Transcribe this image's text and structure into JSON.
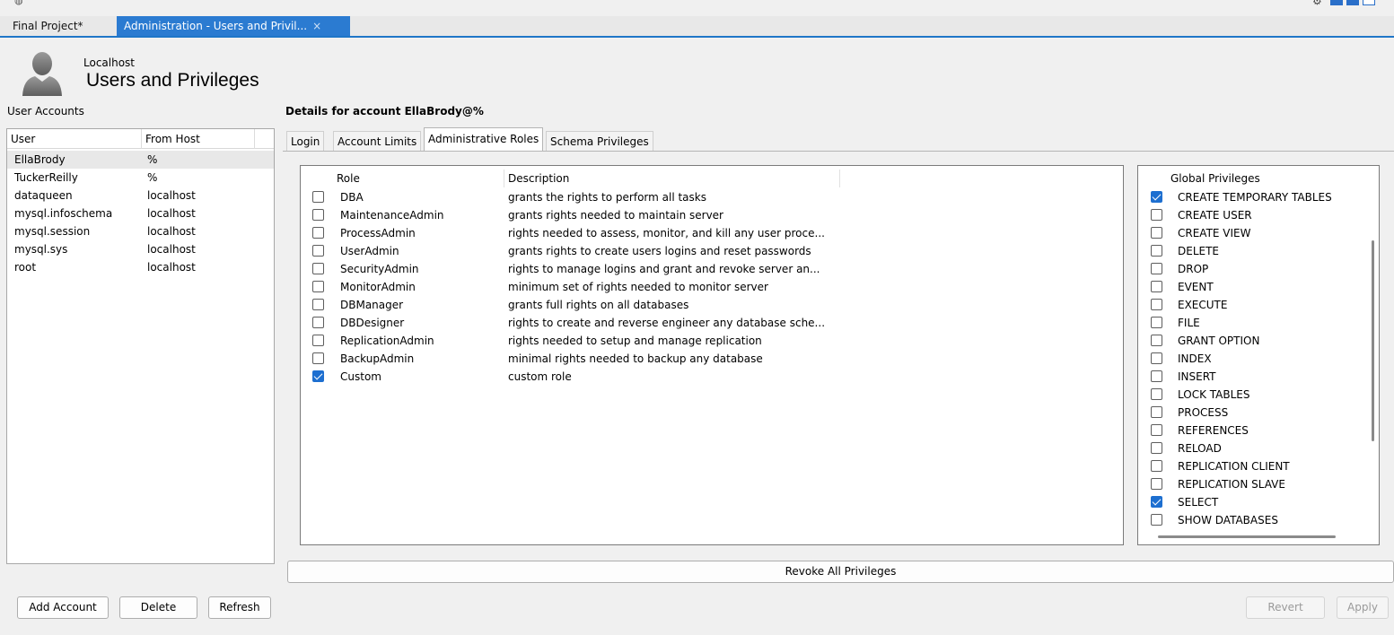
{
  "window": {
    "tabs": [
      "Final Project*",
      "Administration - Users and Privil..."
    ],
    "close_glyph": "×"
  },
  "header": {
    "host": "Localhost",
    "title": "Users and Privileges"
  },
  "accounts": {
    "label": "User Accounts",
    "columns": [
      "User",
      "From Host"
    ],
    "rows": [
      {
        "user": "EllaBrody",
        "host": "%"
      },
      {
        "user": "TuckerReilly",
        "host": "%"
      },
      {
        "user": "dataqueen",
        "host": "localhost"
      },
      {
        "user": "mysql.infoschema",
        "host": "localhost"
      },
      {
        "user": "mysql.session",
        "host": "localhost"
      },
      {
        "user": "mysql.sys",
        "host": "localhost"
      },
      {
        "user": "root",
        "host": "localhost"
      }
    ],
    "selected_index": 0
  },
  "buttons": {
    "add_account": "Add Account",
    "delete": "Delete",
    "refresh": "Refresh",
    "revoke_all": "Revoke All Privileges",
    "revert": "Revert",
    "apply": "Apply"
  },
  "details": {
    "title": "Details for account EllaBrody@%",
    "tabs": [
      "Login",
      "Account Limits",
      "Administrative Roles",
      "Schema Privileges"
    ],
    "active_tab": "Administrative Roles"
  },
  "roles": {
    "columns": [
      "Role",
      "Description"
    ],
    "rows": [
      {
        "role": "DBA",
        "description": "grants the rights to perform all tasks",
        "checked": false
      },
      {
        "role": "MaintenanceAdmin",
        "description": "grants rights needed to maintain server",
        "checked": false
      },
      {
        "role": "ProcessAdmin",
        "description": "rights needed to assess, monitor, and kill any user proce...",
        "checked": false
      },
      {
        "role": "UserAdmin",
        "description": "grants rights to create users logins and reset passwords",
        "checked": false
      },
      {
        "role": "SecurityAdmin",
        "description": "rights to manage logins and grant and revoke server an...",
        "checked": false
      },
      {
        "role": "MonitorAdmin",
        "description": "minimum set of rights needed to monitor server",
        "checked": false
      },
      {
        "role": "DBManager",
        "description": "grants full rights on all databases",
        "checked": false
      },
      {
        "role": "DBDesigner",
        "description": "rights to create and reverse engineer any database sche...",
        "checked": false
      },
      {
        "role": "ReplicationAdmin",
        "description": "rights needed to setup and manage replication",
        "checked": false
      },
      {
        "role": "BackupAdmin",
        "description": "minimal rights needed to backup any database",
        "checked": false
      },
      {
        "role": "Custom",
        "description": "custom role",
        "checked": true
      }
    ]
  },
  "global_privileges": {
    "header": "Global Privileges",
    "rows": [
      {
        "name": "CREATE TEMPORARY TABLES",
        "checked": true
      },
      {
        "name": "CREATE USER",
        "checked": false
      },
      {
        "name": "CREATE VIEW",
        "checked": false
      },
      {
        "name": "DELETE",
        "checked": false
      },
      {
        "name": "DROP",
        "checked": false
      },
      {
        "name": "EVENT",
        "checked": false
      },
      {
        "name": "EXECUTE",
        "checked": false
      },
      {
        "name": "FILE",
        "checked": false
      },
      {
        "name": "GRANT OPTION",
        "checked": false
      },
      {
        "name": "INDEX",
        "checked": false
      },
      {
        "name": "INSERT",
        "checked": false
      },
      {
        "name": "LOCK TABLES",
        "checked": false
      },
      {
        "name": "PROCESS",
        "checked": false
      },
      {
        "name": "REFERENCES",
        "checked": false
      },
      {
        "name": "RELOAD",
        "checked": false
      },
      {
        "name": "REPLICATION CLIENT",
        "checked": false
      },
      {
        "name": "REPLICATION SLAVE",
        "checked": false
      },
      {
        "name": "SELECT",
        "checked": true
      },
      {
        "name": "SHOW DATABASES",
        "checked": false
      }
    ]
  },
  "colors": {
    "accent": "#2b7bd1",
    "check": "#1d6fd0"
  },
  "icons": [
    "workbench-logo-icon",
    "gear-icon",
    "close-icon",
    "user-avatar-icon",
    "checkbox-icon"
  ]
}
